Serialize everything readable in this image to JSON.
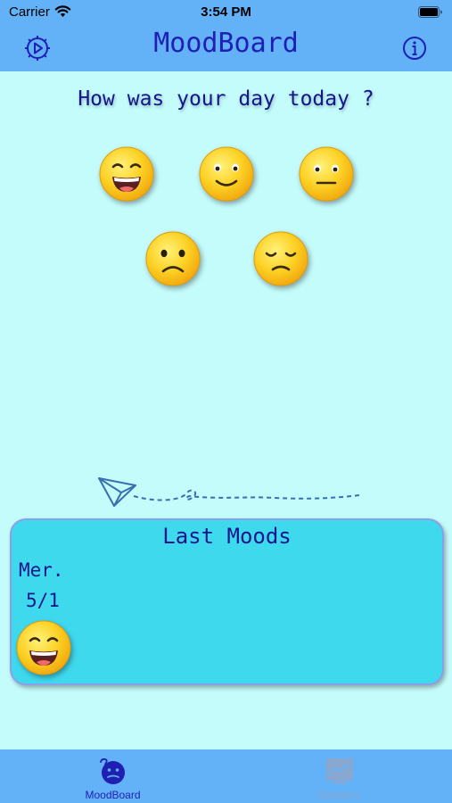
{
  "status_bar": {
    "carrier": "Carrier",
    "time": "3:54 PM",
    "wifi_icon": "wifi-icon",
    "battery_icon": "battery-full-icon"
  },
  "nav_bar": {
    "title": "MoodBoard",
    "left_icon": "gear-icon",
    "right_icon": "info-icon"
  },
  "main": {
    "question": "How was your day today ?",
    "moods": [
      {
        "name": "grinning",
        "icon": "grinning-face-icon"
      },
      {
        "name": "smiling",
        "icon": "smiling-face-icon"
      },
      {
        "name": "neutral",
        "icon": "neutral-face-icon"
      },
      {
        "name": "frowning",
        "icon": "frowning-face-icon"
      },
      {
        "name": "sad",
        "icon": "sad-face-icon"
      }
    ],
    "decoration_icon": "paper-plane-icon"
  },
  "last_moods": {
    "title": "Last Moods",
    "entries": [
      {
        "day": "Mer.",
        "date": "5/1",
        "icon": "grinning-face-icon"
      }
    ]
  },
  "tab_bar": {
    "tabs": [
      {
        "label": "MoodBoard",
        "icon": "mood-face-icon",
        "selected": true
      },
      {
        "label": "Statistics",
        "icon": "chart-icon",
        "selected": false
      }
    ]
  },
  "colors": {
    "background": "#c4fbfb",
    "bars": "#63b1f7",
    "accent": "#1f1fb4",
    "card": "#3fd9ee",
    "emoji_yellow": "#fcc516"
  }
}
